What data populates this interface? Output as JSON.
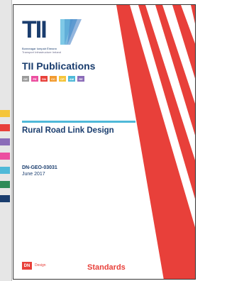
{
  "cover": {
    "logo_text": "TII",
    "logo_subtitle_irish": "Bonneagar Iompair Éireann",
    "logo_subtitle_english": "Transport Infrastructure Ireland",
    "publications_title": "TII Publications",
    "series_codes": [
      {
        "code": "GE",
        "color": "#9b9b9b"
      },
      {
        "code": "PE",
        "color": "#ec4fa0"
      },
      {
        "code": "DN",
        "color": "#e8403a"
      },
      {
        "code": "CC",
        "color": "#f29a2e"
      },
      {
        "code": "CP",
        "color": "#f5c53a"
      },
      {
        "code": "AM",
        "color": "#4fb9d8"
      },
      {
        "code": "RE",
        "color": "#8b6cb8"
      }
    ],
    "document_title": "Rural Road Link Design",
    "document_code": "DN-GEO-03031",
    "document_date": "June 2017",
    "section_badge": "DN",
    "section_name": "Design",
    "category": "Standards"
  },
  "colors": {
    "brand_navy": "#1a3d6e",
    "accent_red": "#e8403a",
    "rule_cyan": "#4fb9d8"
  },
  "left_page_bands": [
    "#f5c53a",
    "#e8403a",
    "#8b6cb8",
    "#ec4fa0",
    "#4fb9d8",
    "#2e8b57",
    "#1a3d6e"
  ]
}
